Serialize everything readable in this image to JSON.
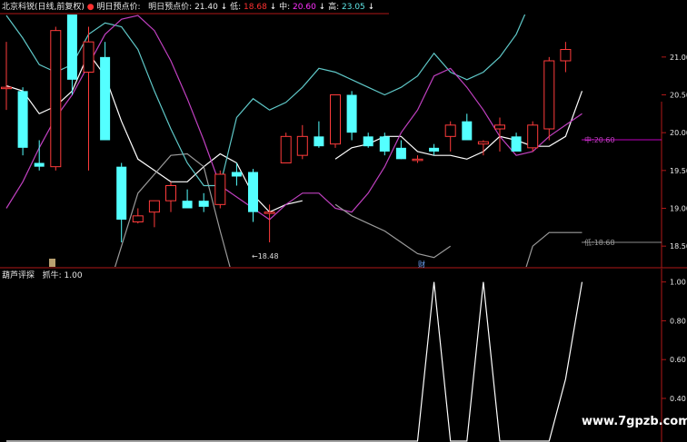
{
  "header": {
    "stock_name": "北京科锐(日线,前复权)",
    "indicator1_label": "明日预点价:",
    "indicator2_label": "明日预点价:",
    "indicator2_value": "21.40",
    "low_label": "低:",
    "low_value": "18.68",
    "mid_label": "中:",
    "mid_value": "20.60",
    "high_label": "高:",
    "high_value": "23.05"
  },
  "sub_header": {
    "name": "葫芦评探",
    "param_label": "抓牛:",
    "param_value": "1.00"
  },
  "colors": {
    "up": "#ff3b3b",
    "down": "#54ffff",
    "purple": "#c040c0",
    "cyan_line": "#5fc8c8",
    "grey_line": "#9a9a9a",
    "white_line": "#ffffff",
    "axis": "#b01818",
    "mid_line": "#c000c0",
    "low_line": "#9a9a9a"
  },
  "markers": {
    "min_price": "18.48",
    "event_tag": "财"
  },
  "watermark": "www.7gpzb.com",
  "chart_data": {
    "type": "candlestick",
    "main_axis": {
      "ylim": [
        18.25,
        21.55
      ],
      "ticks": [
        21.0,
        20.5,
        20.0,
        19.5,
        19.0,
        18.5
      ],
      "tick_labels": [
        "21.00",
        "20.50",
        "20.00",
        "19.50",
        "19.00",
        "18.50"
      ]
    },
    "sub_axis": {
      "ylim": [
        0.18,
        1.05
      ],
      "ticks": [
        1.0,
        0.8,
        0.6,
        0.4
      ],
      "tick_labels": [
        "1.00",
        "0.80",
        "0.60",
        "0.40"
      ]
    },
    "candles": [
      {
        "o": 20.6,
        "h": 21.2,
        "l": 20.3,
        "c": 20.6
      },
      {
        "o": 20.55,
        "h": 20.6,
        "l": 19.7,
        "c": 19.8
      },
      {
        "o": 19.6,
        "h": 19.9,
        "l": 19.5,
        "c": 19.55
      },
      {
        "o": 19.55,
        "h": 21.4,
        "l": 19.5,
        "c": 21.35
      },
      {
        "o": 21.7,
        "h": 22.2,
        "l": 20.5,
        "c": 20.7
      },
      {
        "o": 20.8,
        "h": 21.4,
        "l": 19.5,
        "c": 21.2
      },
      {
        "o": 21.0,
        "h": 21.2,
        "l": 19.9,
        "c": 19.9
      },
      {
        "o": 19.55,
        "h": 19.6,
        "l": 18.55,
        "c": 18.85
      },
      {
        "o": 18.82,
        "h": 19.0,
        "l": 18.8,
        "c": 18.9
      },
      {
        "o": 18.95,
        "h": 19.1,
        "l": 18.75,
        "c": 19.1
      },
      {
        "o": 19.1,
        "h": 19.35,
        "l": 18.95,
        "c": 19.3
      },
      {
        "o": 19.1,
        "h": 19.25,
        "l": 19.05,
        "c": 19.0
      },
      {
        "o": 19.1,
        "h": 19.2,
        "l": 18.95,
        "c": 19.02
      },
      {
        "o": 19.05,
        "h": 19.5,
        "l": 19.0,
        "c": 19.45
      },
      {
        "o": 19.48,
        "h": 19.6,
        "l": 19.3,
        "c": 19.42
      },
      {
        "o": 19.48,
        "h": 19.52,
        "l": 18.82,
        "c": 18.95
      },
      {
        "o": 18.95,
        "h": 19.05,
        "l": 18.55,
        "c": 18.95
      },
      {
        "o": 19.6,
        "h": 20.0,
        "l": 19.6,
        "c": 19.95
      },
      {
        "o": 19.7,
        "h": 20.1,
        "l": 19.65,
        "c": 19.95
      },
      {
        "o": 19.95,
        "h": 20.15,
        "l": 19.8,
        "c": 19.82
      },
      {
        "o": 19.85,
        "h": 20.5,
        "l": 19.8,
        "c": 20.5
      },
      {
        "o": 20.5,
        "h": 20.55,
        "l": 19.9,
        "c": 20.0
      },
      {
        "o": 19.95,
        "h": 20.0,
        "l": 19.8,
        "c": 19.82
      },
      {
        "o": 19.95,
        "h": 20.0,
        "l": 19.7,
        "c": 19.75
      },
      {
        "o": 19.8,
        "h": 19.9,
        "l": 19.65,
        "c": 19.65
      },
      {
        "o": 19.65,
        "h": 19.7,
        "l": 19.6,
        "c": 19.65
      },
      {
        "o": 19.8,
        "h": 19.85,
        "l": 19.7,
        "c": 19.75
      },
      {
        "o": 19.95,
        "h": 20.15,
        "l": 19.75,
        "c": 20.1
      },
      {
        "o": 20.15,
        "h": 20.25,
        "l": 19.9,
        "c": 19.9
      },
      {
        "o": 19.85,
        "h": 19.9,
        "l": 19.7,
        "c": 19.88
      },
      {
        "o": 20.05,
        "h": 20.2,
        "l": 19.75,
        "c": 20.1
      },
      {
        "o": 19.95,
        "h": 20.0,
        "l": 19.75,
        "c": 19.75
      },
      {
        "o": 19.8,
        "h": 20.15,
        "l": 19.75,
        "c": 20.1
      },
      {
        "o": 20.05,
        "h": 21.0,
        "l": 19.9,
        "c": 20.95
      },
      {
        "o": 20.95,
        "h": 21.2,
        "l": 20.8,
        "c": 21.1
      }
    ],
    "lines": [
      {
        "key": "ma_white",
        "points": [
          [
            0,
            20.62
          ],
          [
            1,
            20.55
          ],
          [
            2,
            20.25
          ],
          [
            3,
            20.35
          ],
          [
            4,
            20.55
          ],
          [
            5,
            21.05
          ],
          [
            6,
            20.75
          ],
          [
            7,
            20.15
          ],
          [
            8,
            19.65
          ],
          [
            9,
            19.5
          ],
          [
            10,
            19.35
          ],
          [
            11,
            19.35
          ],
          [
            12,
            19.55
          ],
          [
            13,
            19.72
          ],
          [
            14,
            19.6
          ],
          [
            15,
            19.18
          ],
          [
            16,
            18.95
          ],
          [
            17,
            19.05
          ],
          [
            18,
            19.1
          ],
          [
            19,
            null
          ],
          [
            20,
            19.65
          ],
          [
            21,
            19.8
          ],
          [
            22,
            19.85
          ],
          [
            23,
            19.95
          ],
          [
            24,
            19.95
          ],
          [
            25,
            19.75
          ],
          [
            26,
            19.7
          ],
          [
            27,
            19.7
          ],
          [
            28,
            19.65
          ],
          [
            29,
            19.75
          ],
          [
            30,
            19.95
          ],
          [
            31,
            19.9
          ],
          [
            32,
            19.82
          ],
          [
            33,
            19.82
          ],
          [
            34,
            19.95
          ],
          [
            35,
            20.55
          ]
        ]
      },
      {
        "key": "grey_upper",
        "points": [
          [
            6,
            17.8
          ],
          [
            7,
            18.5
          ],
          [
            8,
            19.2
          ],
          [
            9,
            19.45
          ],
          [
            10,
            19.7
          ],
          [
            11,
            19.72
          ],
          [
            12,
            19.55
          ],
          [
            13,
            18.7
          ],
          [
            14,
            17.9
          ]
        ]
      },
      {
        "key": "cyan_upper",
        "points": [
          [
            0,
            21.55
          ],
          [
            1,
            21.25
          ],
          [
            2,
            20.9
          ],
          [
            3,
            20.8
          ],
          [
            4,
            20.9
          ],
          [
            5,
            21.3
          ],
          [
            6,
            21.45
          ],
          [
            7,
            21.4
          ],
          [
            8,
            21.1
          ],
          [
            9,
            20.55
          ],
          [
            10,
            20.05
          ],
          [
            11,
            19.6
          ],
          [
            12,
            19.3
          ],
          [
            13,
            19.3
          ],
          [
            14,
            20.2
          ],
          [
            15,
            20.45
          ],
          [
            16,
            20.3
          ],
          [
            17,
            20.4
          ],
          [
            18,
            20.6
          ],
          [
            19,
            20.85
          ],
          [
            20,
            20.8
          ],
          [
            21,
            20.7
          ],
          [
            22,
            20.6
          ],
          [
            23,
            20.5
          ],
          [
            24,
            20.6
          ],
          [
            25,
            20.75
          ],
          [
            26,
            21.05
          ],
          [
            27,
            20.8
          ],
          [
            28,
            20.7
          ],
          [
            29,
            20.8
          ],
          [
            30,
            21.0
          ],
          [
            31,
            21.3
          ],
          [
            32,
            21.8
          ],
          [
            33,
            22.4
          ],
          [
            34,
            22.9
          ],
          [
            35,
            23.4
          ]
        ]
      },
      {
        "key": "purple_mid",
        "points": [
          [
            0,
            19.0
          ],
          [
            1,
            19.35
          ],
          [
            2,
            19.8
          ],
          [
            3,
            20.2
          ],
          [
            4,
            20.5
          ],
          [
            5,
            20.9
          ],
          [
            6,
            21.3
          ],
          [
            7,
            21.5
          ],
          [
            8,
            21.55
          ],
          [
            9,
            21.35
          ],
          [
            10,
            20.95
          ],
          [
            11,
            20.45
          ],
          [
            12,
            19.9
          ],
          [
            13,
            19.3
          ],
          [
            14,
            19.15
          ],
          [
            15,
            19.0
          ],
          [
            16,
            18.85
          ],
          [
            17,
            19.05
          ],
          [
            18,
            19.2
          ],
          [
            19,
            19.2
          ],
          [
            20,
            19.0
          ],
          [
            21,
            18.95
          ],
          [
            22,
            19.2
          ],
          [
            23,
            19.55
          ],
          [
            24,
            20.0
          ],
          [
            25,
            20.3
          ],
          [
            26,
            20.75
          ],
          [
            27,
            20.85
          ],
          [
            28,
            20.6
          ],
          [
            29,
            20.3
          ],
          [
            30,
            19.95
          ],
          [
            31,
            19.7
          ],
          [
            32,
            19.75
          ],
          [
            33,
            19.95
          ],
          [
            34,
            20.1
          ],
          [
            35,
            20.25
          ]
        ]
      },
      {
        "key": "grey_lower",
        "points": [
          [
            20,
            19.05
          ],
          [
            21,
            18.9
          ],
          [
            22,
            18.8
          ],
          [
            23,
            18.7
          ],
          [
            24,
            18.55
          ],
          [
            25,
            18.4
          ],
          [
            26,
            18.35
          ],
          [
            27,
            18.5
          ]
        ]
      },
      {
        "key": "lower_right_grey",
        "points": [
          [
            31,
            17.8
          ],
          [
            32,
            18.5
          ],
          [
            33,
            18.68
          ],
          [
            34,
            18.68
          ],
          [
            35,
            18.68
          ]
        ]
      }
    ],
    "mid_line_value": 20.6,
    "low_line_value": 18.68,
    "indicator": [
      [
        0,
        0.18
      ],
      [
        20,
        0.18
      ],
      [
        24,
        0.18
      ],
      [
        25,
        0.18
      ],
      [
        26,
        1.0
      ],
      [
        27,
        0.18
      ],
      [
        28,
        0.18
      ],
      [
        29,
        1.0
      ],
      [
        30,
        0.18
      ],
      [
        33,
        0.18
      ],
      [
        34,
        0.5
      ],
      [
        35,
        1.0
      ]
    ]
  }
}
